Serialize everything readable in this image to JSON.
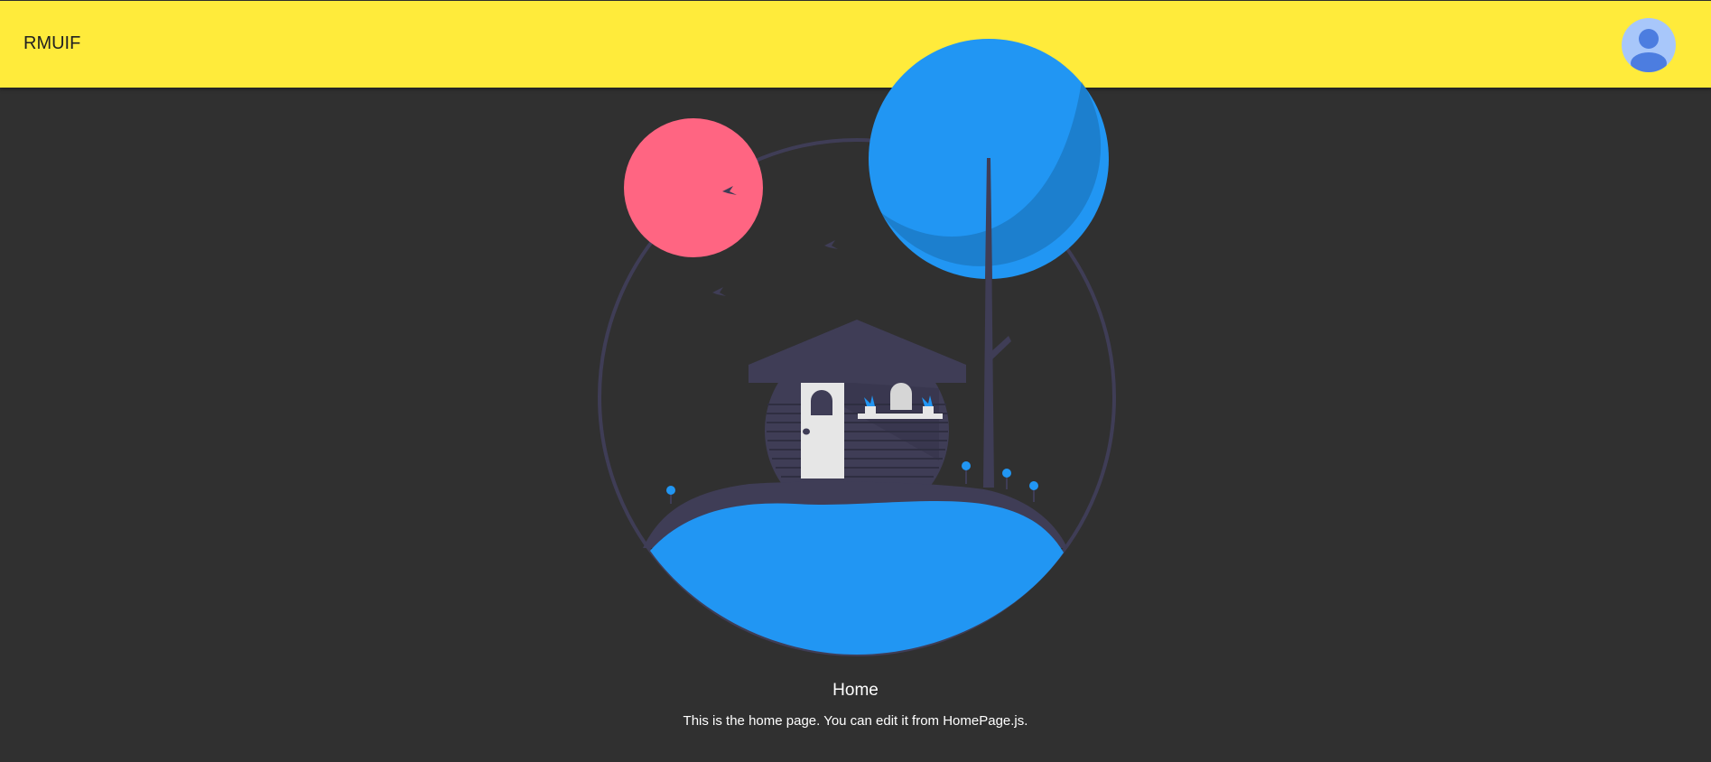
{
  "appbar": {
    "title": "RMUIF",
    "avatar_icon": "account-circle-icon",
    "color": "#ffeb3b"
  },
  "illustration": {
    "icon": "house-by-lake-illustration",
    "colors": {
      "sun": "#ff6582",
      "tree": "#2196f3",
      "lake": "#2196f3",
      "outline": "#3f3d56"
    }
  },
  "main": {
    "heading": "Home",
    "text": "This is the home page. You can edit it from HomePage.js."
  }
}
